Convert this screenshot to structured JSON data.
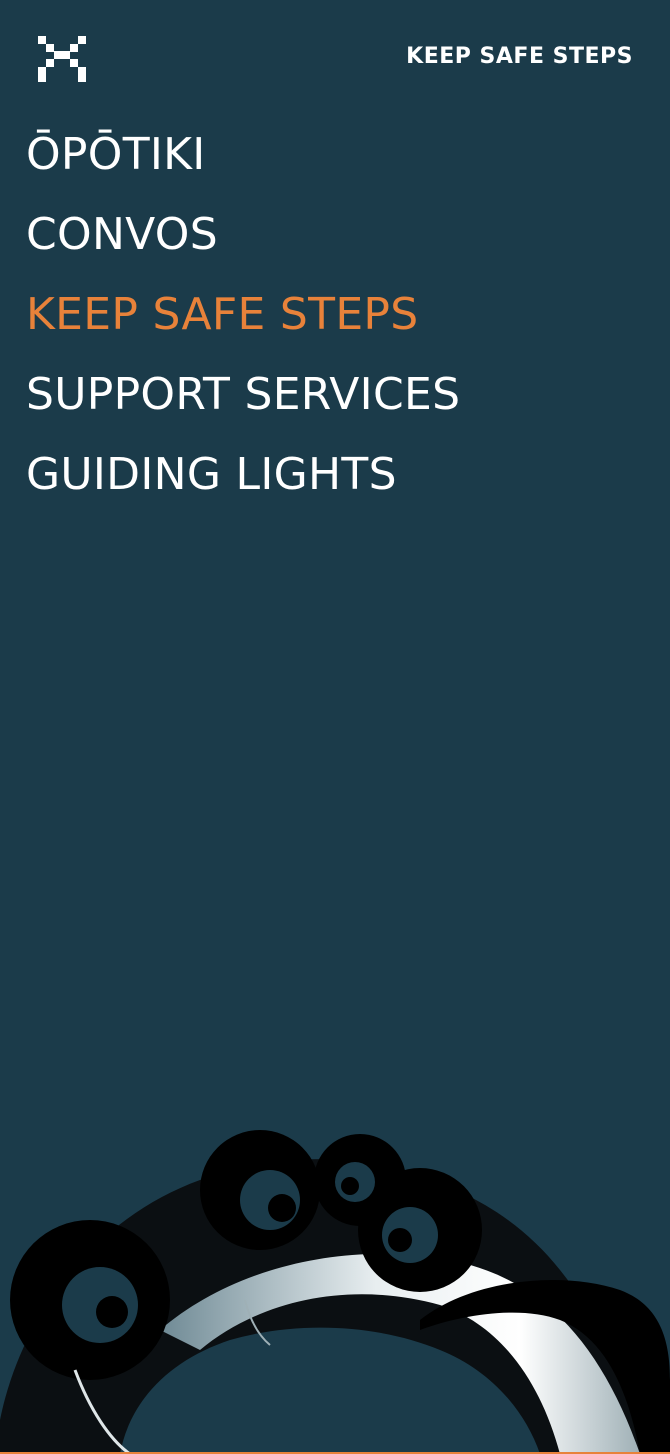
{
  "header": {
    "close_icon": "close-icon",
    "brand_label": "KEEP SAFE STEPS"
  },
  "menu": {
    "items": [
      {
        "label": "ŌPŌTIKI",
        "active": false
      },
      {
        "label": "CONVOS",
        "active": false
      },
      {
        "label": "KEEP SAFE STEPS",
        "active": true
      },
      {
        "label": "SUPPORT SERVICES",
        "active": false
      },
      {
        "label": "GUIDING LIGHTS",
        "active": false
      }
    ]
  },
  "colors": {
    "background": "#1b3b4a",
    "text": "#ffffff",
    "accent": "#e8823a"
  },
  "artwork": {
    "name": "koru-artwork-illustration"
  }
}
